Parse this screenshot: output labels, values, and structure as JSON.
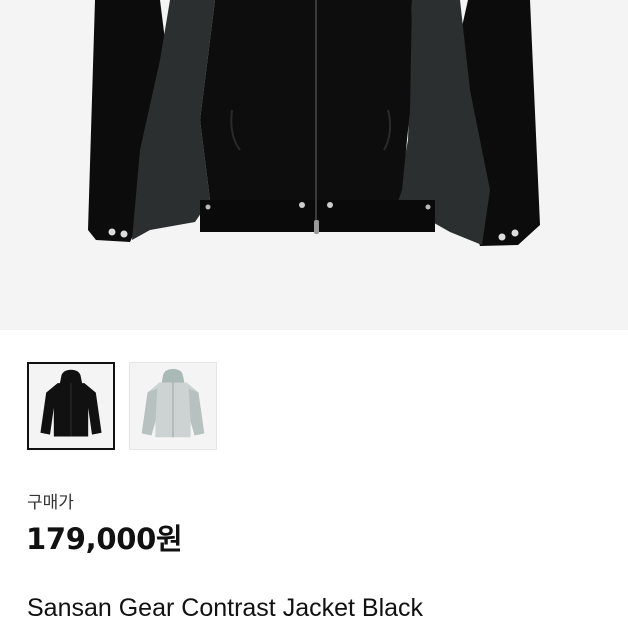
{
  "product": {
    "price_label": "구매가",
    "price": "179,000원",
    "name": "Sansan Gear Contrast Jacket Black"
  },
  "thumbnails": [
    {
      "label": "Black",
      "selected": true,
      "color": "#111111"
    },
    {
      "label": "Light Grey",
      "selected": false,
      "color": "#c9d0cf"
    }
  ],
  "colors": {
    "hero_background": "#f4f4f4",
    "jacket_body": "#0d0d0d",
    "jacket_contrast_panel": "#2b2f2f"
  }
}
